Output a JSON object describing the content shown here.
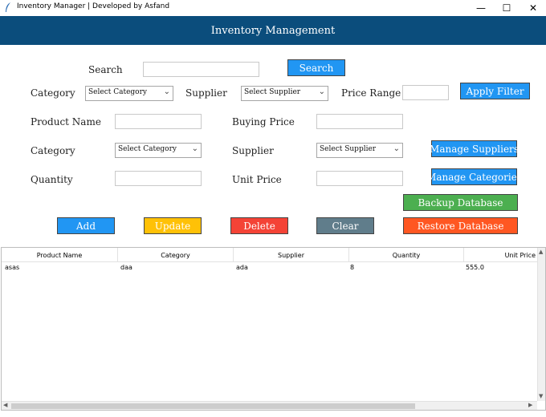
{
  "window": {
    "title": "Inventory Manager | Developed by Asfand",
    "min": "—",
    "max": "☐",
    "close": "✕"
  },
  "banner": {
    "title": "Inventory Management"
  },
  "search": {
    "label": "Search",
    "value": "",
    "button": "Search"
  },
  "filter": {
    "category_label": "Category",
    "category_select": "Select Category",
    "supplier_label": "Supplier",
    "supplier_select": "Select Supplier",
    "price_range_label": "Price Range",
    "price_range_value": "",
    "apply_button": "Apply Filter"
  },
  "form": {
    "product_name_label": "Product Name",
    "product_name_value": "",
    "buying_price_label": "Buying Price",
    "buying_price_value": "",
    "category_label": "Category",
    "category_select": "Select Category",
    "supplier_label": "Supplier",
    "supplier_select": "Select Supplier",
    "quantity_label": "Quantity",
    "quantity_value": "",
    "unit_price_label": "Unit Price",
    "unit_price_value": ""
  },
  "side_buttons": {
    "manage_suppliers": "Manage Suppliers",
    "manage_categories": "Manage Categories",
    "backup_database": "Backup Database",
    "restore_database": "Restore Database"
  },
  "actions": {
    "add": "Add",
    "update": "Update",
    "delete": "Delete",
    "clear": "Clear"
  },
  "colors": {
    "banner": "#0b4d7c",
    "blue": "#2196f3",
    "yellow": "#ffc107",
    "red": "#f44336",
    "slate": "#607d8b",
    "green": "#4caf50",
    "orange": "#ff5722"
  },
  "table": {
    "columns": [
      "Product Name",
      "Category",
      "Supplier",
      "Quantity",
      "Unit Price"
    ],
    "rows": [
      [
        "asas",
        "daa",
        "ada",
        "8",
        "555.0"
      ]
    ]
  }
}
